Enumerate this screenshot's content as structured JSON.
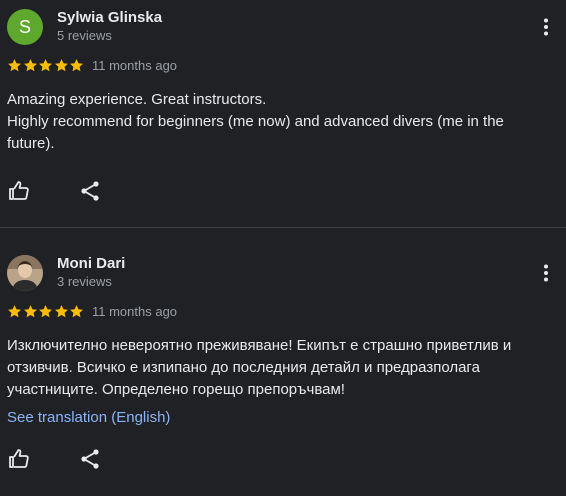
{
  "reviews": [
    {
      "author": "Sylwia Glinska",
      "avatar_letter": "S",
      "avatar_color": "#5fa82e",
      "review_count": "5 reviews",
      "rating": 5,
      "date": "11 months ago",
      "text_lines": [
        "Amazing experience. Great instructors.",
        "Highly recommend for beginners (me now) and advanced divers (me in the",
        "future)."
      ],
      "icons": {
        "more": "more-vert-icon",
        "like": "thumb-up-icon",
        "share": "share-icon"
      }
    },
    {
      "author": "Moni Dari",
      "review_count": "3 reviews",
      "rating": 5,
      "date": "11 months ago",
      "text_lines": [
        "Изключително невероятно преживяване! Екипът е страшно приветлив и",
        "отзивчив. Всичко е изпипано до последния детайл и предразполага",
        "участниците. Определено горещо препоръчвам!"
      ],
      "translation_link": "See translation (English)",
      "icons": {
        "more": "more-vert-icon",
        "like": "thumb-up-icon",
        "share": "share-icon"
      }
    }
  ],
  "colors": {
    "background": "#202124",
    "star": "#fbbc04",
    "link": "#8ab4f8",
    "secondary_text": "#9aa0a6",
    "divider": "#3c4043"
  }
}
